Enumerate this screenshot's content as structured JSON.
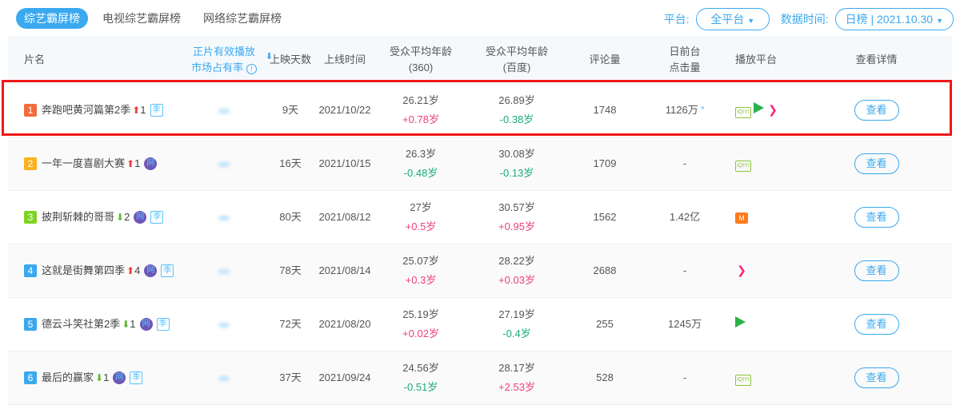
{
  "tabs": [
    "综艺霸屏榜",
    "电视综艺霸屏榜",
    "网络综艺霸屏榜"
  ],
  "filters": {
    "platform_label": "平台:",
    "platform_value": "全平台",
    "date_label": "数据时间:",
    "date_value": "日榜 | 2021.10.30"
  },
  "headers": {
    "name": "片名",
    "share_1": "正片有效播放",
    "share_2": "市场占有率",
    "days": "上映天数",
    "date": "上线时间",
    "age360_1": "受众平均年龄",
    "age360_2": "(360)",
    "agebd_1": "受众平均年龄",
    "agebd_2": "(百度)",
    "comments": "评论量",
    "clicks_1": "日前台",
    "clicks_2": "点击量",
    "platforms": "播放平台",
    "detail": "查看详情"
  },
  "colors": {
    "accent": "#3aa9ef",
    "rank1": "#f46b3b",
    "rank2": "#fbb21d",
    "rank3": "#7ed321",
    "rank_other": "#3aa9ef",
    "highlight": "#f01818"
  },
  "rows": [
    {
      "rank": "1",
      "name": "奔跑吧黄河篇第2季",
      "trend": "up",
      "change": "1",
      "wang": false,
      "ji": true,
      "ji_label": "季",
      "days": "9天",
      "date": "2021/10/22",
      "age360": "26.21岁",
      "age360_delta": "+0.78岁",
      "agebd": "26.89岁",
      "agebd_delta": "-0.38岁",
      "comments": "1748",
      "clicks": "1126万",
      "clicks_star": "*",
      "platforms": [
        "iqiyi",
        "tencent",
        "youku"
      ],
      "detail": "查看"
    },
    {
      "rank": "2",
      "name": "一年一度喜剧大赛",
      "trend": "up",
      "change": "1",
      "wang": true,
      "ji": false,
      "wang_label": "网",
      "days": "16天",
      "date": "2021/10/15",
      "age360": "26.3岁",
      "age360_delta": "-0.48岁",
      "agebd": "30.08岁",
      "agebd_delta": "-0.13岁",
      "comments": "1709",
      "clicks": "-",
      "platforms": [
        "iqiyi"
      ],
      "detail": "查看"
    },
    {
      "rank": "3",
      "name": "披荆斩棘的哥哥",
      "trend": "down",
      "change": "2",
      "wang": true,
      "ji": true,
      "wang_label": "网",
      "ji_label": "季",
      "days": "80天",
      "date": "2021/08/12",
      "age360": "27岁",
      "age360_delta": "+0.5岁",
      "agebd": "30.57岁",
      "agebd_delta": "+0.95岁",
      "comments": "1562",
      "clicks": "1.42亿",
      "platforms": [
        "mango"
      ],
      "detail": "查看"
    },
    {
      "rank": "4",
      "name": "这就是街舞第四季",
      "trend": "up",
      "change": "4",
      "wang": true,
      "ji": true,
      "wang_label": "网",
      "ji_label": "季",
      "days": "78天",
      "date": "2021/08/14",
      "age360": "25.07岁",
      "age360_delta": "+0.3岁",
      "agebd": "28.22岁",
      "agebd_delta": "+0.03岁",
      "comments": "2688",
      "clicks": "-",
      "platforms": [
        "youku"
      ],
      "detail": "查看"
    },
    {
      "rank": "5",
      "name": "德云斗笑社第2季",
      "trend": "down",
      "change": "1",
      "wang": true,
      "ji": true,
      "wang_label": "网",
      "ji_label": "季",
      "days": "72天",
      "date": "2021/08/20",
      "age360": "25.19岁",
      "age360_delta": "+0.02岁",
      "agebd": "27.19岁",
      "agebd_delta": "-0.4岁",
      "comments": "255",
      "clicks": "1245万",
      "platforms": [
        "tencent"
      ],
      "detail": "查看"
    },
    {
      "rank": "6",
      "name": "最后的赢家",
      "trend": "down",
      "change": "1",
      "wang": true,
      "ji": true,
      "wang_label": "网",
      "ji_label": "季",
      "days": "37天",
      "date": "2021/09/24",
      "age360": "24.56岁",
      "age360_delta": "-0.51岁",
      "agebd": "28.17岁",
      "agebd_delta": "+2.53岁",
      "comments": "528",
      "clicks": "-",
      "platforms": [
        "iqiyi"
      ],
      "detail": "查看"
    }
  ]
}
